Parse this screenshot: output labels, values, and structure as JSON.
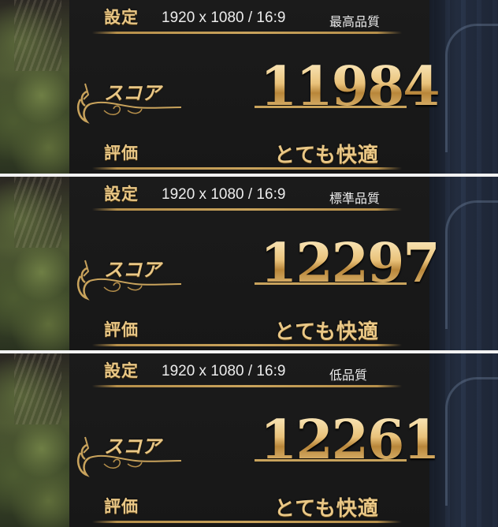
{
  "results": [
    {
      "setting_label": "設定",
      "resolution": "1920 x 1080 / 16:9",
      "quality": "最高品質",
      "score_label": "スコア",
      "score": "11984",
      "evaluation_label": "評価",
      "evaluation": "とても快適"
    },
    {
      "setting_label": "設定",
      "resolution": "1920 x 1080 / 16:9",
      "quality": "標準品質",
      "score_label": "スコア",
      "score": "12297",
      "evaluation_label": "評価",
      "evaluation": "とても快適"
    },
    {
      "setting_label": "設定",
      "resolution": "1920 x 1080 / 16:9",
      "quality": "低品質",
      "score_label": "スコア",
      "score": "12261",
      "evaluation_label": "評価",
      "evaluation": "とても快適"
    }
  ],
  "colors": {
    "gold": "#e9c786",
    "separator": "#f2f2f2",
    "panel_background": "#1a1a1a"
  }
}
